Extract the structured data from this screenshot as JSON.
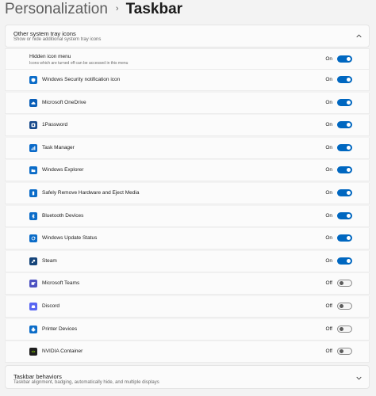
{
  "breadcrumb": {
    "parent": "Personalization",
    "separator": "›",
    "current": "Taskbar"
  },
  "tray_section": {
    "title": "Other system tray icons",
    "subtitle": "Show or hide additional system tray icons",
    "chevron_icon": "chevron-up-icon"
  },
  "hidden_icon_menu": {
    "title": "Hidden icon menu",
    "subtitle": "Icons which are turned off can be accessed in this menu",
    "state": "On",
    "on": true
  },
  "tray_items": [
    {
      "label": "Windows Security notification icon",
      "state": "On",
      "on": true,
      "icon": "shield-icon",
      "color": "#0b6cc8"
    },
    {
      "label": "Microsoft OneDrive",
      "state": "On",
      "on": true,
      "icon": "cloud-icon",
      "color": "#0b5fb8"
    },
    {
      "label": "1Password",
      "state": "On",
      "on": true,
      "icon": "key-icon",
      "color": "#1a4b8c"
    },
    {
      "label": "Task Manager",
      "state": "On",
      "on": true,
      "icon": "chart-icon",
      "color": "#0a6ac9"
    },
    {
      "label": "Windows Explorer",
      "state": "On",
      "on": true,
      "icon": "folder-icon",
      "color": "#0b6cc8"
    },
    {
      "label": "Safely Remove Hardware and Eject Media",
      "state": "On",
      "on": true,
      "icon": "usb-icon",
      "color": "#0b6cc8"
    },
    {
      "label": "Bluetooth Devices",
      "state": "On",
      "on": true,
      "icon": "bluetooth-icon",
      "color": "#0b6cc8"
    },
    {
      "label": "Windows Update Status",
      "state": "On",
      "on": true,
      "icon": "update-icon",
      "color": "#0b6cc8"
    },
    {
      "label": "Steam",
      "state": "On",
      "on": true,
      "icon": "steam-icon",
      "color": "#16457a"
    },
    {
      "label": "Microsoft Teams",
      "state": "Off",
      "on": false,
      "icon": "teams-icon",
      "color": "#4d52c1"
    },
    {
      "label": "Discord",
      "state": "Off",
      "on": false,
      "icon": "discord-icon",
      "color": "#5865f2"
    },
    {
      "label": "Printer Devices",
      "state": "Off",
      "on": false,
      "icon": "printer-icon",
      "color": "#0b6cc8"
    },
    {
      "label": "NVIDIA Container",
      "state": "Off",
      "on": false,
      "icon": "nvidia-icon",
      "color": "#1e1e1e"
    }
  ],
  "behaviors_section": {
    "title": "Taskbar behaviors",
    "subtitle": "Taskbar alignment, badging, automatically hide, and multiple displays",
    "chevron_icon": "chevron-down-icon"
  },
  "colors": {
    "accent": "#0067c0",
    "background": "#f3f3f3",
    "card": "#fbfbfb"
  }
}
